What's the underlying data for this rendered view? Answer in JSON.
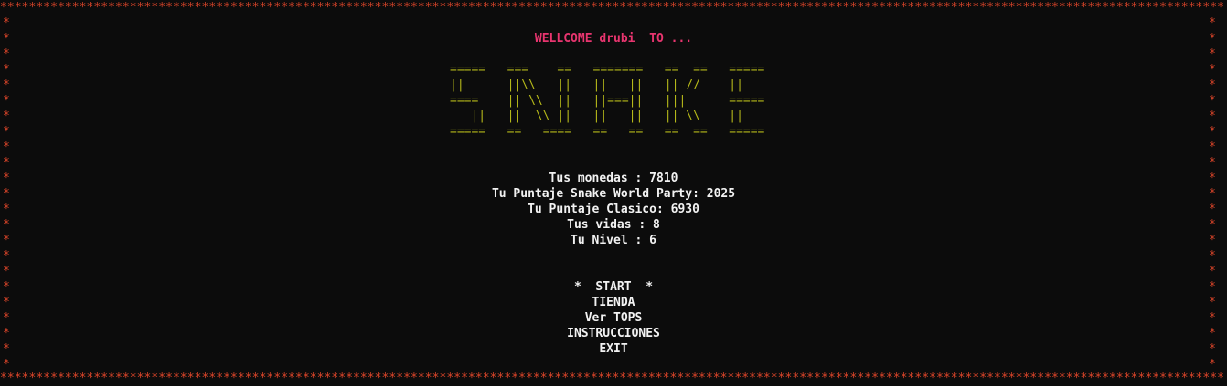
{
  "colors": {
    "border": "#e0462a",
    "welcome": "#e8356f",
    "ascii_art": "#b5b81a",
    "text": "#f2f2f2",
    "background": "#0c0c0c"
  },
  "border_char": "*",
  "welcome": "WELLCOME drubi  TO ...",
  "ascii_art": [
    "=====   ===    ==   =======   ==  ==   =====",
    "||      ||\\\\   ||   ||   ||   || //    ||",
    "====    || \\\\  ||   ||===||   |||      =====",
    "   ||   ||  \\\\ ||   ||   ||   || \\\\    ||",
    "=====   ==   ====   ==   ==   ==  ==   ====="
  ],
  "stats": {
    "monedas": "Tus monedas : 7810",
    "puntaje_world": "Tu Puntaje Snake World Party: 2025",
    "puntaje_clasico": "Tu Puntaje Clasico: 6930",
    "vidas": "Tus vidas : 8",
    "nivel": "Tu Nivel : 6"
  },
  "menu": {
    "start": "*  START  *",
    "tienda": "TIENDA",
    "tops": "Ver TOPS",
    "instrucciones": "INSTRUCCIONES",
    "exit": "EXIT"
  }
}
